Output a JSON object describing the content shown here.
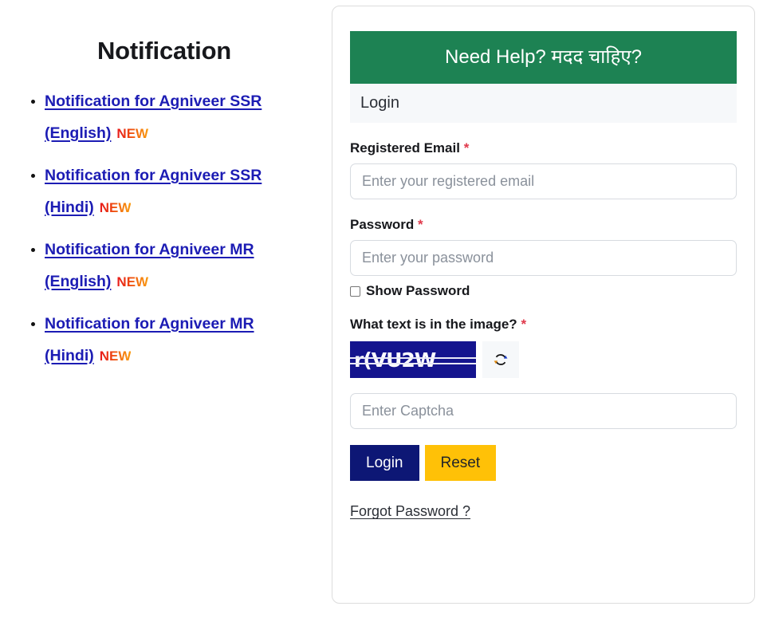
{
  "notification": {
    "title": "Notification",
    "items": [
      {
        "link": "Notification for Agniveer SSR (English)",
        "badge": "NEW"
      },
      {
        "link": "Notification for Agniveer SSR (Hindi)",
        "badge": "NEW"
      },
      {
        "link": "Notification for Agniveer MR (English)",
        "badge": "NEW"
      },
      {
        "link": "Notification for Agniveer MR (Hindi)",
        "badge": "NEW"
      }
    ]
  },
  "login_card": {
    "help_banner": "Need Help? मदद चाहिए?",
    "panel_title": "Login",
    "email": {
      "label": "Registered Email",
      "required_mark": "*",
      "placeholder": "Enter your registered email",
      "value": ""
    },
    "password": {
      "label": "Password",
      "required_mark": "*",
      "placeholder": "Enter your password",
      "value": ""
    },
    "show_password": {
      "label": "Show Password",
      "checked": false
    },
    "captcha": {
      "label": "What text is in the image?",
      "required_mark": "*",
      "image_text": "r(VU2W",
      "refresh_icon": "refresh-icon",
      "placeholder": "Enter Captcha",
      "value": ""
    },
    "buttons": {
      "login": "Login",
      "reset": "Reset"
    },
    "forgot_password": "Forgot Password ?"
  },
  "colors": {
    "banner_green": "#1d8253",
    "link_blue": "#1c1cb4",
    "login_navy": "#0d1775",
    "reset_gold": "#ffc107",
    "required_red": "#e0394b",
    "captcha_bg": "#14148e",
    "badge_start": "#e8191b",
    "badge_end": "#f99a10"
  }
}
